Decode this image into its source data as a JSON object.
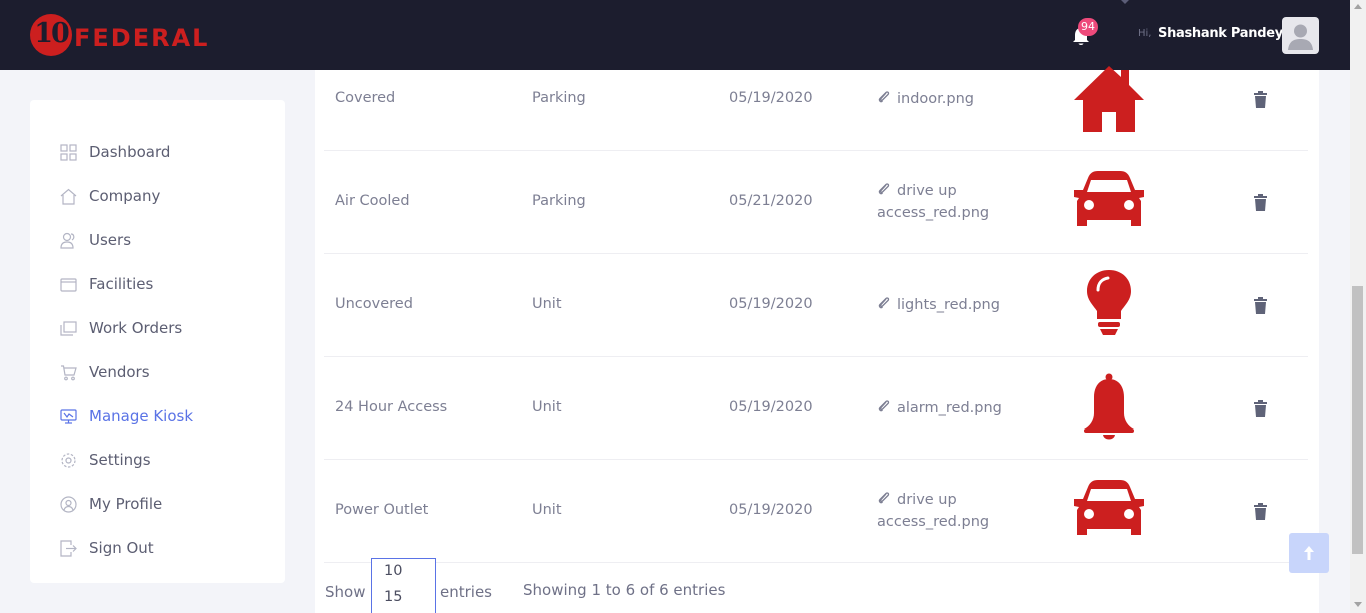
{
  "brand": {
    "logo_number": "10",
    "logo_word": "FEDERAL"
  },
  "header": {
    "notification_count": "94",
    "greeting": "Hi,",
    "user_name": "Shashank Pandey"
  },
  "sidebar": {
    "items": [
      {
        "label": "Dashboard",
        "icon": "dashboard-icon",
        "active": false
      },
      {
        "label": "Company",
        "icon": "home-icon",
        "active": false
      },
      {
        "label": "Users",
        "icon": "users-icon",
        "active": false
      },
      {
        "label": "Facilities",
        "icon": "facilities-icon",
        "active": false
      },
      {
        "label": "Work Orders",
        "icon": "work-orders-icon",
        "active": false
      },
      {
        "label": "Vendors",
        "icon": "cart-icon",
        "active": false
      },
      {
        "label": "Manage Kiosk",
        "icon": "kiosk-icon",
        "active": true
      },
      {
        "label": "Settings",
        "icon": "gear-icon",
        "active": false
      },
      {
        "label": "My Profile",
        "icon": "profile-icon",
        "active": false
      },
      {
        "label": "Sign Out",
        "icon": "sign-out-icon",
        "active": false
      }
    ]
  },
  "table": {
    "rows": [
      {
        "name": "Covered",
        "type": "Parking",
        "date": "05/19/2020",
        "file": "indoor.png",
        "icon": "house-icon"
      },
      {
        "name": "Air Cooled",
        "type": "Parking",
        "date": "05/21/2020",
        "file": "drive up access_red.png",
        "icon": "car-icon"
      },
      {
        "name": "Uncovered",
        "type": "Unit",
        "date": "05/19/2020",
        "file": "lights_red.png",
        "icon": "lightbulb-icon"
      },
      {
        "name": "24 Hour Access",
        "type": "Unit",
        "date": "05/19/2020",
        "file": "alarm_red.png",
        "icon": "bell-alarm-icon"
      },
      {
        "name": "Power Outlet",
        "type": "Unit",
        "date": "05/19/2020",
        "file": "drive up access_red.png",
        "icon": "car-icon"
      }
    ]
  },
  "footer": {
    "show_label": "Show",
    "options": [
      "10",
      "15"
    ],
    "entries_label": "entries",
    "info": "Showing 1 to 6 of 6 entries"
  },
  "colors": {
    "accent": "#5a73e6",
    "brand_red": "#cc1f1f",
    "topbar": "#1c1d2e",
    "badge": "#ee4a7b"
  }
}
